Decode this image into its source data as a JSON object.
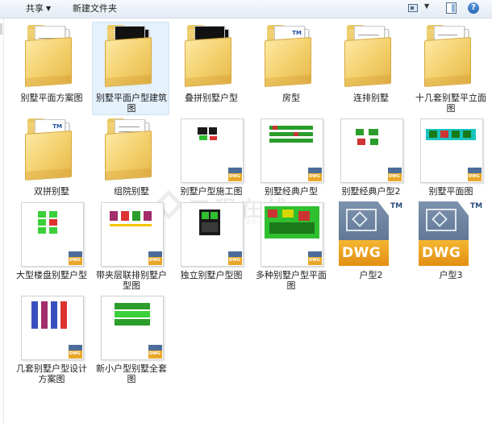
{
  "toolbar": {
    "share": "共享",
    "new_folder": "新建文件夹"
  },
  "watermark": {
    "text": "工程在线",
    "sub": "co188.com"
  },
  "items": [
    {
      "label": "别墅平面方案图",
      "kind": "folder"
    },
    {
      "label": "别墅平面户型建筑图",
      "kind": "folder",
      "selected": true
    },
    {
      "label": "叠拼别墅户型",
      "kind": "folder"
    },
    {
      "label": "房型",
      "kind": "folder"
    },
    {
      "label": "连排别墅",
      "kind": "folder"
    },
    {
      "label": "十几套别墅平立面图",
      "kind": "folder"
    },
    {
      "label": "双拼别墅",
      "kind": "folder"
    },
    {
      "label": "组院别墅",
      "kind": "folder"
    },
    {
      "label": "别墅户型施工图",
      "kind": "dwg-thumb"
    },
    {
      "label": "别墅经典户型",
      "kind": "dwg-thumb"
    },
    {
      "label": "别墅经典户型2",
      "kind": "dwg-thumb"
    },
    {
      "label": "别墅平面图",
      "kind": "dwg-thumb"
    },
    {
      "label": "大型楼盘别墅户型",
      "kind": "dwg-thumb"
    },
    {
      "label": "带夹层联排别墅户型图",
      "kind": "dwg-thumb"
    },
    {
      "label": "独立别墅户型图",
      "kind": "dwg-thumb"
    },
    {
      "label": "多种别墅户型平面图",
      "kind": "dwg-thumb"
    },
    {
      "label": "户型2",
      "kind": "dwg-icon"
    },
    {
      "label": "户型3",
      "kind": "dwg-icon"
    },
    {
      "label": "几套别墅户型设计方案图",
      "kind": "dwg-thumb"
    },
    {
      "label": "新小户型别墅全套图",
      "kind": "dwg-thumb"
    }
  ],
  "badge_text": "DWG",
  "tm_text": "TM",
  "colors": {
    "folder": "#f3cf6a",
    "selection": "#e5f1fb",
    "dwg_orange": "#e9a727",
    "dwg_blue": "#4f6685"
  },
  "icons": {
    "share": "share-menu",
    "view": "view-options-icon",
    "preview": "preview-pane-icon",
    "help": "help-icon"
  }
}
